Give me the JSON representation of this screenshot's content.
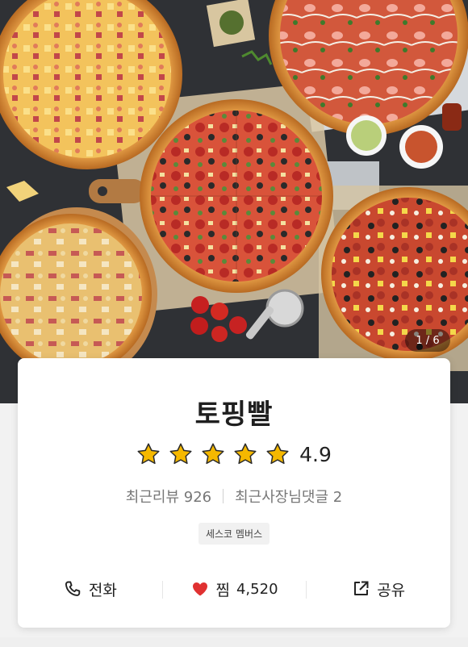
{
  "hero": {
    "image_description_icon": "pizza-photo",
    "page_indicator": "1 / 6"
  },
  "store": {
    "name": "토핑빨",
    "rating": "4.9",
    "star_count": 5,
    "recent_reviews": "최근리뷰 926",
    "recent_owner_comments": "최근사장님댓글 2",
    "badge": "세스코 멤버스"
  },
  "actions": {
    "call_label": "전화",
    "favorite_label": "찜",
    "favorite_count": "4,520",
    "share_label": "공유"
  },
  "colors": {
    "star": "#f5b800",
    "heart": "#e03131",
    "text": "#222222"
  }
}
